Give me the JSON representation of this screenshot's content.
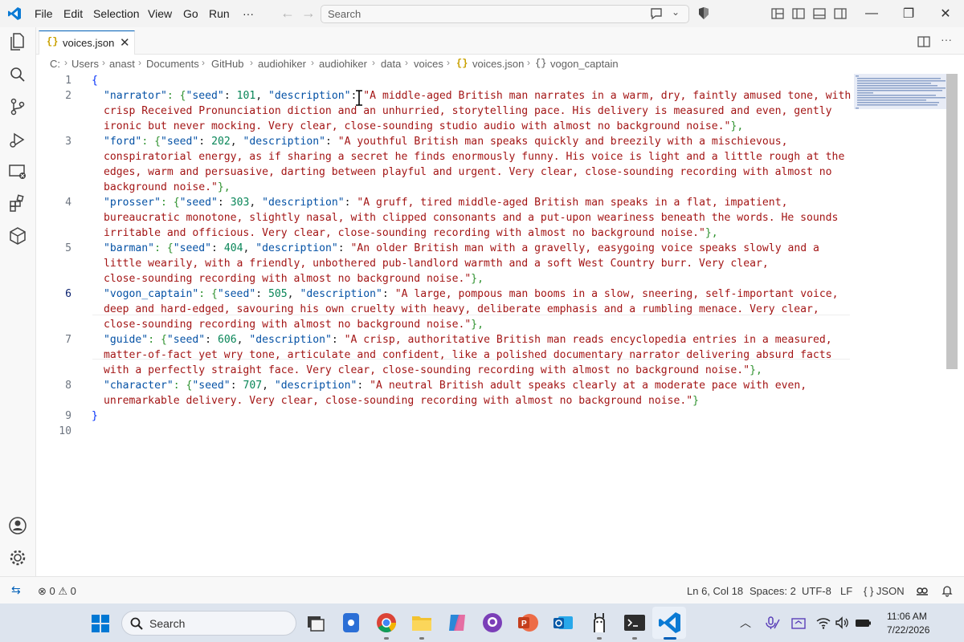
{
  "menu": [
    "File",
    "Edit",
    "Selection",
    "View",
    "Go",
    "Run",
    "···"
  ],
  "search": {
    "placeholder": "Search"
  },
  "tab": {
    "label": "voices.json"
  },
  "breadcrumb": [
    "C:",
    "Users",
    "anast",
    "Documents",
    "GitHub",
    "audiohiker",
    "audiohiker",
    "data",
    "voices",
    "voices.json",
    "vogon_captain"
  ],
  "editor": {
    "line_numbers": [
      "1",
      "2",
      "3",
      "4",
      "5",
      "6",
      "7",
      "8",
      "9",
      "10"
    ],
    "lines": {
      "open_brace": "{",
      "close_brace": "}",
      "narrator_1a": "\"narrator\"",
      "narrator_1b": ": {",
      "narrator_1c": "\"seed\"",
      "narrator_1d": ": ",
      "narrator_1e": "101",
      "narrator_1f": ", ",
      "narrator_1g": "\"description\"",
      "narrator_1h": ": ",
      "narrator_1i": "\"A middle-aged British man narrates in a warm, dry, faintly amused tone, with",
      "narrator_2": "crisp Received Pronunciation diction and an unhurried, storytelling pace. His delivery is measured and even, gently",
      "narrator_3a": "ironic but never mocking. Very clear, close-sounding studio audio with almost no background noise.\"",
      "narrator_3b": "},",
      "ford_1a": "\"ford\"",
      "ford_1b": ": {",
      "ford_1c": "\"seed\"",
      "ford_1d": ": ",
      "ford_1e": "202",
      "ford_1f": ", ",
      "ford_1g": "\"description\"",
      "ford_1h": ": ",
      "ford_1i": "\"A youthful British man speaks quickly and breezily with a mischievous,",
      "ford_2": "conspiratorial energy, as if sharing a secret he finds enormously funny. His voice is light and a little rough at the",
      "ford_3": "edges, warm and persuasive, darting between playful and urgent. Very clear, close-sounding recording with almost no",
      "ford_4a": "background noise.\"",
      "ford_4b": "},",
      "prosser_1a": "\"prosser\"",
      "prosser_1b": ": {",
      "prosser_1c": "\"seed\"",
      "prosser_1d": ": ",
      "prosser_1e": "303",
      "prosser_1f": ", ",
      "prosser_1g": "\"description\"",
      "prosser_1h": ": ",
      "prosser_1i": "\"A gruff, tired middle-aged British man speaks in a flat, impatient,",
      "prosser_2": "bureaucratic monotone, slightly nasal, with clipped consonants and a put-upon weariness beneath the words. He sounds",
      "prosser_3a": "irritable and officious. Very clear, close-sounding recording with almost no background noise.\"",
      "prosser_3b": "},",
      "barman_1a": "\"barman\"",
      "barman_1b": ": {",
      "barman_1c": "\"seed\"",
      "barman_1d": ": ",
      "barman_1e": "404",
      "barman_1f": ", ",
      "barman_1g": "\"description\"",
      "barman_1h": ": ",
      "barman_1i": "\"An older British man with a gravelly, easygoing voice speaks slowly and a",
      "barman_2": "little wearily, with a friendly, unbothered pub-landlord warmth and a soft West Country burr. Very clear,",
      "barman_3a": "close-sounding recording with almost no background noise.\"",
      "barman_3b": "},",
      "vogon_1a": "\"vogon_captain\"",
      "vogon_1b": ": {",
      "vogon_1c": "\"seed\"",
      "vogon_1d": ": ",
      "vogon_1e": "505",
      "vogon_1f": ", ",
      "vogon_1g": "\"description\"",
      "vogon_1h": ": ",
      "vogon_1i": "\"A large, pompous man booms in a slow, sneering, self-important voice,",
      "vogon_2": "deep and hard-edged, savouring his own cruelty with heavy, deliberate emphasis and a rumbling menace. Very clear,",
      "vogon_3a": "close-sounding recording with almost no background noise.\"",
      "vogon_3b": "},",
      "guide_1a": "\"guide\"",
      "guide_1b": ": {",
      "guide_1c": "\"seed\"",
      "guide_1d": ": ",
      "guide_1e": "606",
      "guide_1f": ", ",
      "guide_1g": "\"description\"",
      "guide_1h": ": ",
      "guide_1i": "\"A crisp, authoritative British man reads encyclopedia entries in a measured,",
      "guide_2": "matter-of-fact yet wry tone, articulate and confident, like a polished documentary narrator delivering absurd facts",
      "guide_3a": "with a perfectly straight face. Very clear, close-sounding recording with almost no background noise.\"",
      "guide_3b": "},",
      "char_1a": "\"character\"",
      "char_1b": ": {",
      "char_1c": "\"seed\"",
      "char_1d": ": ",
      "char_1e": "707",
      "char_1f": ", ",
      "char_1g": "\"description\"",
      "char_1h": ": ",
      "char_1i": "\"A neutral British adult speaks clearly at a moderate pace with even,",
      "char_2a": "unremarkable delivery. Very clear, close-sounding recording with almost no background noise.\"",
      "char_2b": "}"
    }
  },
  "status": {
    "errors": "0",
    "warnings": "0",
    "position": "Ln 6, Col 18",
    "spaces": "Spaces: 2",
    "encoding": "UTF-8",
    "eol": "LF",
    "language": "{ } JSON"
  },
  "taskbar": {
    "search_label": "Search",
    "time": "11:06 AM",
    "date": "7/22/2026"
  },
  "colors": {
    "accent": "#005fb8",
    "key": "#0451a5",
    "string": "#a31515",
    "number": "#098658"
  }
}
